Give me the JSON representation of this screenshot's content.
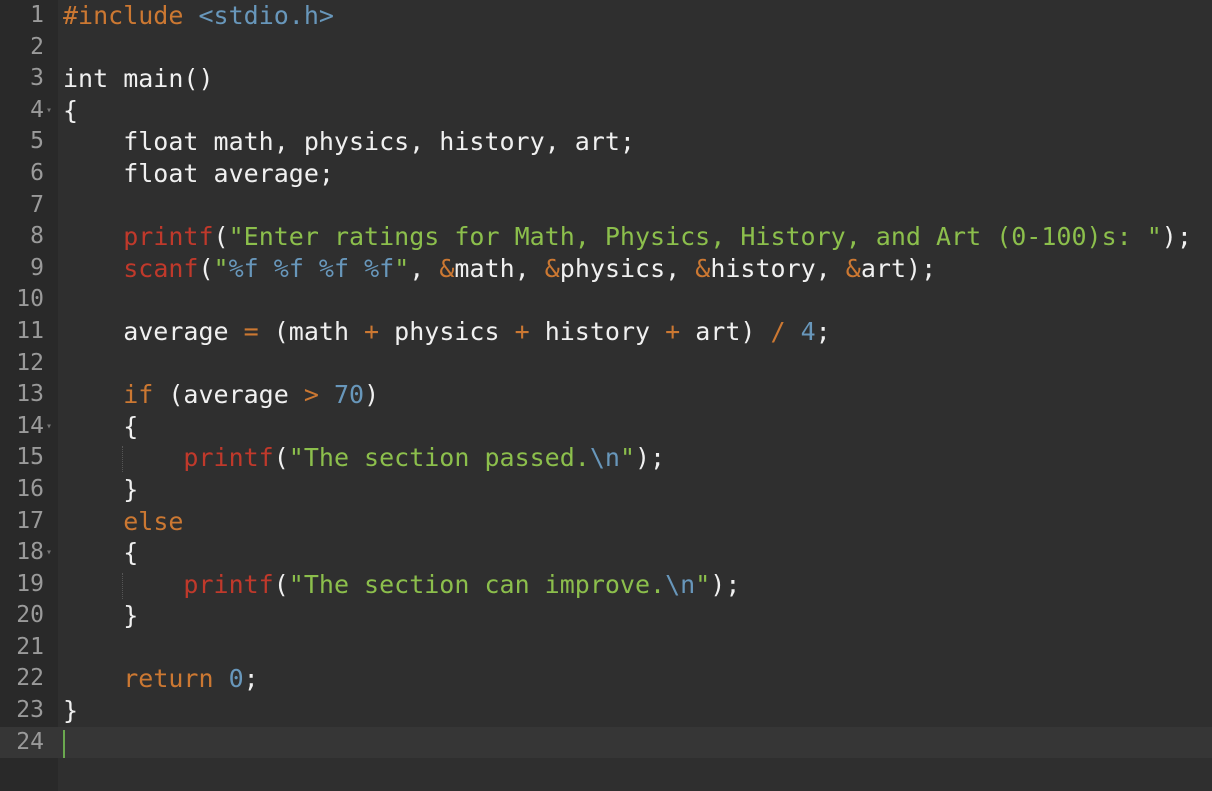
{
  "editor": {
    "current_line": 24,
    "lines": [
      {
        "n": "1",
        "t": [
          [
            "pp",
            "#include"
          ],
          [
            "",
            "&nbsp;"
          ],
          [
            "inc",
            "<stdio.h>"
          ]
        ]
      },
      {
        "n": "2",
        "t": []
      },
      {
        "n": "3",
        "t": [
          [
            "",
            "int main()"
          ]
        ]
      },
      {
        "n": "4",
        "fold": true,
        "t": [
          [
            "",
            "{"
          ]
        ]
      },
      {
        "n": "5",
        "t": [
          [
            "",
            "    float math, physics, history, art;"
          ]
        ]
      },
      {
        "n": "6",
        "t": [
          [
            "",
            "    float average;"
          ]
        ]
      },
      {
        "n": "7",
        "t": []
      },
      {
        "n": "8",
        "t": [
          [
            "",
            "    "
          ],
          [
            "fn",
            "printf"
          ],
          [
            "",
            "("
          ],
          [
            "str",
            "\"Enter ratings for Math, Physics, History, and Art (0-100)s: \""
          ],
          [
            "",
            ");"
          ]
        ]
      },
      {
        "n": "9",
        "t": [
          [
            "",
            "    "
          ],
          [
            "fn",
            "scanf"
          ],
          [
            "",
            "("
          ],
          [
            "str",
            "\""
          ],
          [
            "esc",
            "%f %f %f %f"
          ],
          [
            "str",
            "\""
          ],
          [
            "",
            ", "
          ],
          [
            "op",
            "&"
          ],
          [
            "",
            "math, "
          ],
          [
            "op",
            "&"
          ],
          [
            "",
            "physics, "
          ],
          [
            "op",
            "&"
          ],
          [
            "",
            "history, "
          ],
          [
            "op",
            "&"
          ],
          [
            "",
            "art);"
          ]
        ]
      },
      {
        "n": "10",
        "t": []
      },
      {
        "n": "11",
        "t": [
          [
            "",
            "    average "
          ],
          [
            "op",
            "="
          ],
          [
            "",
            " (math "
          ],
          [
            "op",
            "+"
          ],
          [
            "",
            ""
          ],
          [
            "",
            ""
          ],
          [
            "",
            " physics "
          ],
          [
            "op",
            "+"
          ],
          [
            "",
            " history "
          ],
          [
            "op",
            "+"
          ],
          [
            "",
            " art) "
          ],
          [
            "op",
            "/"
          ],
          [
            "",
            " "
          ],
          [
            "numc",
            "4"
          ],
          [
            "",
            ";"
          ]
        ]
      },
      {
        "n": "12",
        "t": []
      },
      {
        "n": "13",
        "t": [
          [
            "",
            "    "
          ],
          [
            "kw",
            "if"
          ],
          [
            "",
            " (average "
          ],
          [
            "op",
            ">"
          ],
          [
            "",
            " "
          ],
          [
            "numc",
            "70"
          ],
          [
            "",
            ")"
          ]
        ]
      },
      {
        "n": "14",
        "fold": true,
        "t": [
          [
            "",
            "    {"
          ]
        ]
      },
      {
        "n": "15",
        "guide": true,
        "t": [
          [
            "",
            "        "
          ],
          [
            "fn",
            "printf"
          ],
          [
            "",
            "("
          ],
          [
            "str",
            "\"The section passed."
          ],
          [
            "esc",
            "\\n"
          ],
          [
            "str",
            "\""
          ],
          [
            "",
            ");"
          ]
        ]
      },
      {
        "n": "16",
        "t": [
          [
            "",
            "    }"
          ]
        ]
      },
      {
        "n": "17",
        "t": [
          [
            "",
            "    "
          ],
          [
            "kw",
            "else"
          ]
        ]
      },
      {
        "n": "18",
        "fold": true,
        "t": [
          [
            "",
            "    {"
          ]
        ]
      },
      {
        "n": "19",
        "guide": true,
        "t": [
          [
            "",
            "        "
          ],
          [
            "fn",
            "printf"
          ],
          [
            "",
            "("
          ],
          [
            "str",
            "\"The section can improve."
          ],
          [
            "esc",
            "\\n"
          ],
          [
            "str",
            "\""
          ],
          [
            "",
            ");"
          ]
        ]
      },
      {
        "n": "20",
        "t": [
          [
            "",
            "    }"
          ]
        ]
      },
      {
        "n": "21",
        "t": []
      },
      {
        "n": "22",
        "t": [
          [
            "",
            "    "
          ],
          [
            "kw",
            "return"
          ],
          [
            "",
            " "
          ],
          [
            "numc",
            "0"
          ],
          [
            "",
            ";"
          ]
        ]
      },
      {
        "n": "23",
        "t": [
          [
            "",
            "}"
          ]
        ]
      },
      {
        "n": "24",
        "t": []
      }
    ]
  }
}
